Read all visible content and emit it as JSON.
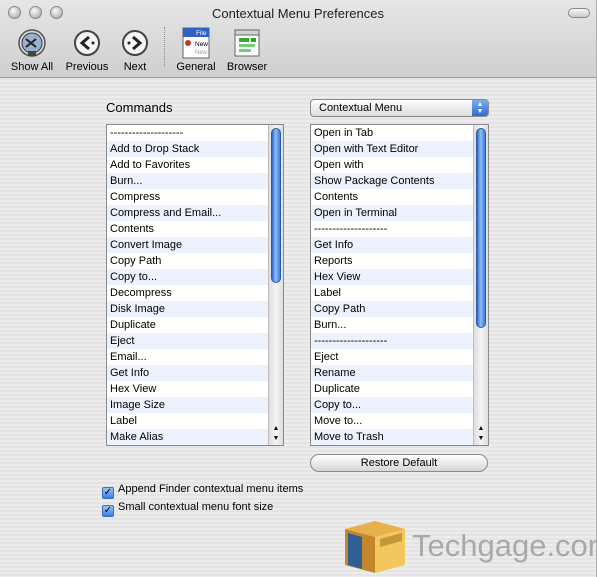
{
  "window": {
    "title": "Contextual Menu Preferences"
  },
  "toolbar": {
    "items": [
      {
        "label": "Show All",
        "icon": "show-all-icon"
      },
      {
        "label": "Previous",
        "icon": "previous-arrow-icon"
      },
      {
        "label": "Next",
        "icon": "next-arrow-icon"
      },
      {
        "label": "General",
        "icon": "general-prefs-icon",
        "icon_text": [
          "File",
          "New",
          "New"
        ]
      },
      {
        "label": "Browser",
        "icon": "browser-prefs-icon"
      }
    ]
  },
  "commands": {
    "title": "Commands",
    "items": [
      "--------------------",
      "Add to Drop Stack",
      "Add to Favorites",
      "Burn...",
      "Compress",
      "Compress and Email...",
      "Contents",
      "Convert Image",
      "Copy Path",
      "Copy to...",
      "Decompress",
      "Disk Image",
      "Duplicate",
      "Eject",
      "Email...",
      "Get Info",
      "Hex View",
      "Image Size",
      "Label",
      "Make Alias"
    ]
  },
  "context_menu": {
    "selected": "Contextual Menu",
    "items": [
      "Open in Tab",
      "Open with Text Editor",
      "Open with",
      "Show Package Contents",
      "Contents",
      "Open in Terminal",
      "--------------------",
      "Get Info",
      "Reports",
      "Hex View",
      "Label",
      "Copy Path",
      "Burn...",
      "--------------------",
      "Eject",
      "Rename",
      "Duplicate",
      "Copy to...",
      "Move to...",
      "Move to Trash"
    ]
  },
  "restore_label": "Restore Default",
  "options": [
    {
      "label": "Append Finder contextual menu items",
      "checked": true
    },
    {
      "label": "Small contextual menu font size",
      "checked": true
    }
  ],
  "watermark": "Techgage.com",
  "colors": {
    "accent": "#3d7de0",
    "row_stripe": "#edf3fe"
  }
}
